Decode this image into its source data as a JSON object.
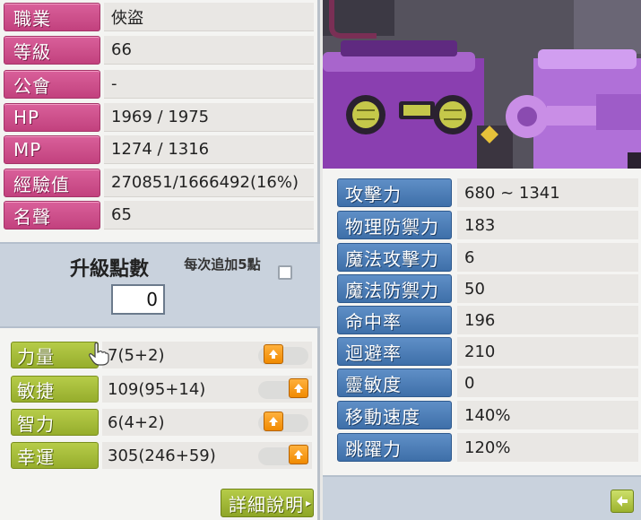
{
  "char_info": [
    {
      "label": "職業",
      "value": "俠盜"
    },
    {
      "label": "等級",
      "value": "66"
    },
    {
      "label": "公會",
      "value": "-"
    },
    {
      "label": "HP",
      "value": "1969 / 1975"
    },
    {
      "label": "MP",
      "value": "1274 / 1316"
    },
    {
      "label": "經驗值",
      "value": "270851/1666492(16%)"
    },
    {
      "label": "名聲",
      "value": "65"
    }
  ],
  "level_up": {
    "title": "升級點數",
    "points": "0",
    "add5_label": "每次追加5點",
    "add5_checked": false
  },
  "stats": [
    {
      "label": "力量",
      "value": "7(5+2)"
    },
    {
      "label": "敏捷",
      "value": "109(95+14)"
    },
    {
      "label": "智力",
      "value": "6(4+2)"
    },
    {
      "label": "幸運",
      "value": "305(246+59)"
    }
  ],
  "detail_button": "詳細說明",
  "battle_stats": [
    {
      "label": "攻擊力",
      "value": "680 ~ 1341"
    },
    {
      "label": "物理防禦力",
      "value": "183"
    },
    {
      "label": "魔法攻擊力",
      "value": "6"
    },
    {
      "label": "魔法防禦力",
      "value": "50"
    },
    {
      "label": "命中率",
      "value": "196"
    },
    {
      "label": "迴避率",
      "value": "210"
    },
    {
      "label": "靈敏度",
      "value": "0"
    },
    {
      "label": "移動速度",
      "value": "140%"
    },
    {
      "label": "跳躍力",
      "value": "120%"
    }
  ],
  "colors": {
    "info_label": "#c94b87",
    "stat_label": "#a3bb38",
    "battle_label": "#4d7db8",
    "up_button": "#f59a1a"
  }
}
